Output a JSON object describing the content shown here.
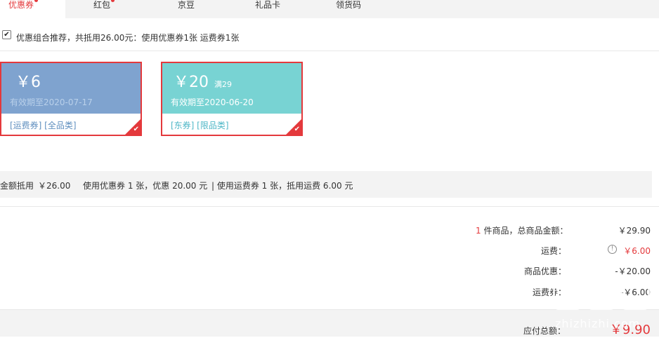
{
  "tabs": [
    {
      "label": "优惠券",
      "active": true,
      "dot": true
    },
    {
      "label": "红包",
      "active": false,
      "dot": true
    },
    {
      "label": "京豆",
      "active": false,
      "dot": false
    },
    {
      "label": "礼品卡",
      "active": false,
      "dot": false
    },
    {
      "label": "领货码",
      "active": false,
      "dot": false
    }
  ],
  "recommend": {
    "checked": true,
    "text": "优惠组合推荐，共抵用26.00元：使用优惠券1张 运费券1张"
  },
  "coupons": [
    {
      "price": "￥6",
      "condition": "",
      "valid": "有效期至2020-07-17",
      "tags": "[运费券] [全品类]",
      "selected": true,
      "color": "#7fa3cf"
    },
    {
      "price": "￥20",
      "condition": "满29",
      "valid": "有效期至2020-06-20",
      "tags": "[东券] [限品类]",
      "selected": true,
      "color": "#78d3d3"
    }
  ],
  "summary": {
    "label": "金额抵用",
    "amount": "￥26.00",
    "coupon_text": "使用优惠券 1 张，优惠 20.00 元",
    "freight_text": "| 使用运费券 1 张，抵用运费 6.00 元"
  },
  "totals": {
    "count": "1",
    "count_label": "件商品，总商品金额：",
    "goods_amount": "￥29.90",
    "freight_label": "运费：",
    "freight_amount": "￥6.00",
    "discount_label": "商品优惠：",
    "discount_amount": "-￥20.00",
    "freight_coupon_label": "运费券：",
    "freight_coupon_amount": "-￥6.00",
    "payable_label": "应付总额：",
    "payable_amount": "￥9.90"
  },
  "watermark": {
    "text": "zhizhizhi.com"
  }
}
